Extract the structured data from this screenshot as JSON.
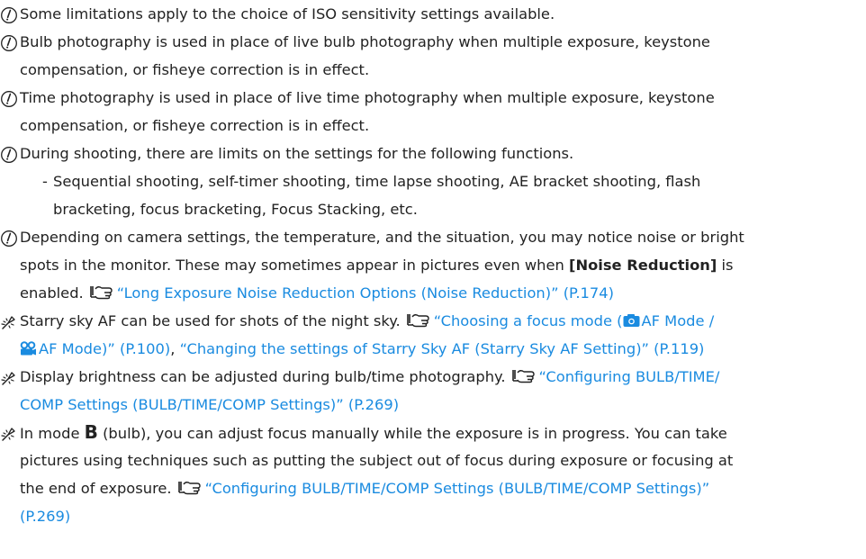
{
  "notes": [
    {
      "icon": "caution-icon",
      "lines": [
        "Some limitations apply to the choice of ISO sensitivity settings available."
      ]
    },
    {
      "icon": "caution-icon",
      "lines": [
        "Bulb photography is used in place of live bulb photography when multiple exposure, keystone",
        "compensation, or fisheye correction is in effect."
      ]
    },
    {
      "icon": "caution-icon",
      "lines": [
        "Time photography is used in place of live time photography when multiple exposure, keystone",
        "compensation, or fisheye correction is in effect."
      ]
    },
    {
      "icon": "caution-icon",
      "lines": [
        "During shooting, there are limits on the settings for the following functions."
      ]
    },
    {
      "bullet": "-",
      "lines": [
        "Sequential shooting, self-timer shooting, time lapse shooting, AE bracket shooting, flash",
        "bracketing, focus bracketing, Focus Stacking, etc."
      ]
    },
    {
      "icon": "caution-icon",
      "line1": "Depending on camera settings, the temperature, and the situation, you may notice noise or bright",
      "line2a": "spots in the monitor. These may sometimes appear in pictures even when ",
      "line2b": "[Noise Reduction]",
      "line2c": " is",
      "line3a": "enabled.",
      "line3link": "“Long Exposure Noise Reduction Options (Noise Reduction)” (P.174)"
    },
    {
      "icon": "tip-icon",
      "line1a": "Starry sky AF can be used for shots of the night sky.",
      "line1link": "“Choosing a focus mode (",
      "line1link2": "AF Mode /",
      "line2link1": "AF Mode)” (P.100)",
      "line2sep": ", ",
      "line2link2": "“Changing the settings of Starry Sky AF (Starry Sky AF Setting)” (P.119)"
    },
    {
      "icon": "tip-icon",
      "line1a": "Display brightness can be adjusted during bulb/time photography.",
      "line1link": "“Configuring BULB/TIME/",
      "line2link": "COMP Settings (BULB/TIME/COMP Settings)” (P.269)"
    },
    {
      "icon": "tip-icon",
      "line1a": "In mode ",
      "line1b": "B",
      "line1c": " (bulb), you can adjust focus manually while the exposure is in progress. You can take",
      "line2": "pictures using techniques such as putting the subject out of focus during exposure or focusing at",
      "line3a": "the end of exposure.",
      "line3link": "“Configuring BULB/TIME/COMP Settings (BULB/TIME/COMP Settings)”",
      "line4link": "(P.269)"
    }
  ]
}
